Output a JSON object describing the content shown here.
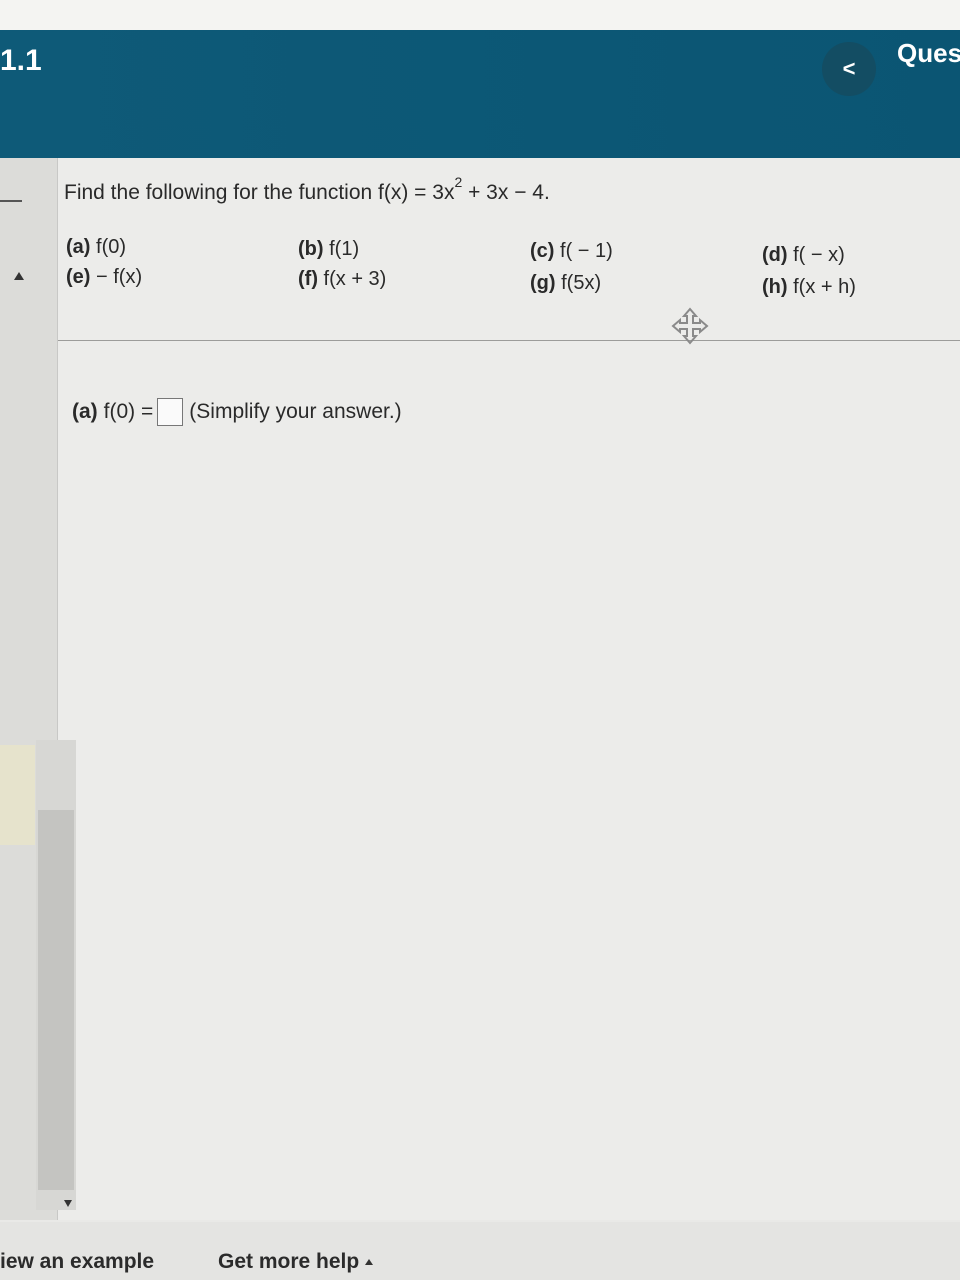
{
  "header": {
    "section": "1.1",
    "back_icon": "chevron-left-icon",
    "back_glyph": "<",
    "question_label": "Ques"
  },
  "problem": {
    "prompt_prefix": "Find the following for the function f(x) = 3x",
    "prompt_exponent": "2",
    "prompt_suffix": " + 3x − 4.",
    "parts": [
      {
        "label": "(a)",
        "expr": "f(0)"
      },
      {
        "label": "(b)",
        "expr": "f(1)"
      },
      {
        "label": "(c)",
        "expr": "f( − 1)"
      },
      {
        "label": "(d)",
        "expr": "f( − x)"
      },
      {
        "label": "(e)",
        "expr": "− f(x)"
      },
      {
        "label": "(f)",
        "expr": "f(x + 3)"
      },
      {
        "label": "(g)",
        "expr": "f(5x)"
      },
      {
        "label": "(h)",
        "expr": "f(x + h)"
      }
    ]
  },
  "answer": {
    "label": "(a)",
    "expr": "f(0) =",
    "value": "",
    "hint": "(Simplify your answer.)"
  },
  "footer": {
    "view_example": "iew an example",
    "get_help": "Get more help"
  },
  "colors": {
    "header_bg": "#0e5a78",
    "back_btn_bg": "#134d63"
  }
}
